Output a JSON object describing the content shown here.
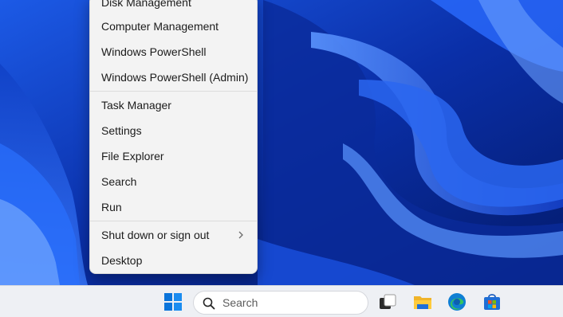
{
  "menu": {
    "items": [
      {
        "label": "Disk Management"
      },
      {
        "label": "Computer Management"
      },
      {
        "label": "Windows PowerShell"
      },
      {
        "label": "Windows PowerShell (Admin)"
      },
      {
        "label": "Task Manager"
      },
      {
        "label": "Settings"
      },
      {
        "label": "File Explorer"
      },
      {
        "label": "Search"
      },
      {
        "label": "Run"
      },
      {
        "label": "Shut down or sign out",
        "submenu_icon": "chevron-right-icon"
      },
      {
        "label": "Desktop"
      }
    ]
  },
  "taskbar": {
    "search_placeholder": "Search",
    "icons": [
      "windows-start-icon",
      "search-icon",
      "task-view-icon",
      "file-explorer-icon",
      "edge-icon",
      "store-icon"
    ]
  },
  "colors": {
    "wallpaper_dark": "#031a6b",
    "wallpaper_light": "#3d7bff",
    "menu_bg": "#f3f3f3",
    "taskbar_bg": "#eef0f4",
    "start_blue": "#0a74da"
  }
}
